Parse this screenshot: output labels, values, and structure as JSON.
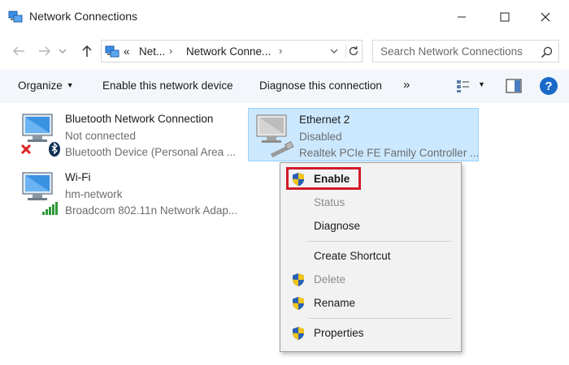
{
  "window": {
    "title": "Network Connections"
  },
  "address": {
    "crumbs": [
      "«",
      "Net...",
      "Network Conne..."
    ],
    "search_placeholder": "Search Network Connections"
  },
  "toolbar": {
    "organize": "Organize",
    "enable_device": "Enable this network device",
    "diagnose": "Diagnose this connection",
    "more": "»"
  },
  "adapters": [
    {
      "name": "Bluetooth Network Connection",
      "status": "Not connected",
      "device": "Bluetooth Device (Personal Area ..."
    },
    {
      "name": "Wi-Fi",
      "status": "hm-network",
      "device": "Broadcom 802.11n Network Adap..."
    },
    {
      "name": "Ethernet 2",
      "status": "Disabled",
      "device": "Realtek PCIe FE Family Controller ..."
    }
  ],
  "context_menu": {
    "items": [
      {
        "label": "Enable",
        "shield": true,
        "enabled": true,
        "bold": true
      },
      {
        "label": "Status",
        "shield": false,
        "enabled": false
      },
      {
        "label": "Diagnose",
        "shield": false,
        "enabled": true
      },
      {
        "label": "Create Shortcut",
        "shield": false,
        "enabled": true
      },
      {
        "label": "Delete",
        "shield": true,
        "enabled": false
      },
      {
        "label": "Rename",
        "shield": true,
        "enabled": true
      },
      {
        "label": "Properties",
        "shield": true,
        "enabled": true
      }
    ]
  },
  "colors": {
    "selection_bg": "#cce8ff",
    "selection_border": "#99d1ff",
    "highlight_red": "#d11a2a",
    "help_blue": "#1b6ac9"
  },
  "icons": [
    "network-connections-icon",
    "back-arrow-icon",
    "forward-arrow-icon",
    "up-arrow-icon",
    "refresh-icon",
    "search-icon",
    "view-options-icon",
    "preview-pane-icon",
    "help-icon",
    "monitor-icon",
    "red-x-icon",
    "bluetooth-icon",
    "wifi-bars-icon",
    "ethernet-cable-icon",
    "uac-shield-icon"
  ]
}
